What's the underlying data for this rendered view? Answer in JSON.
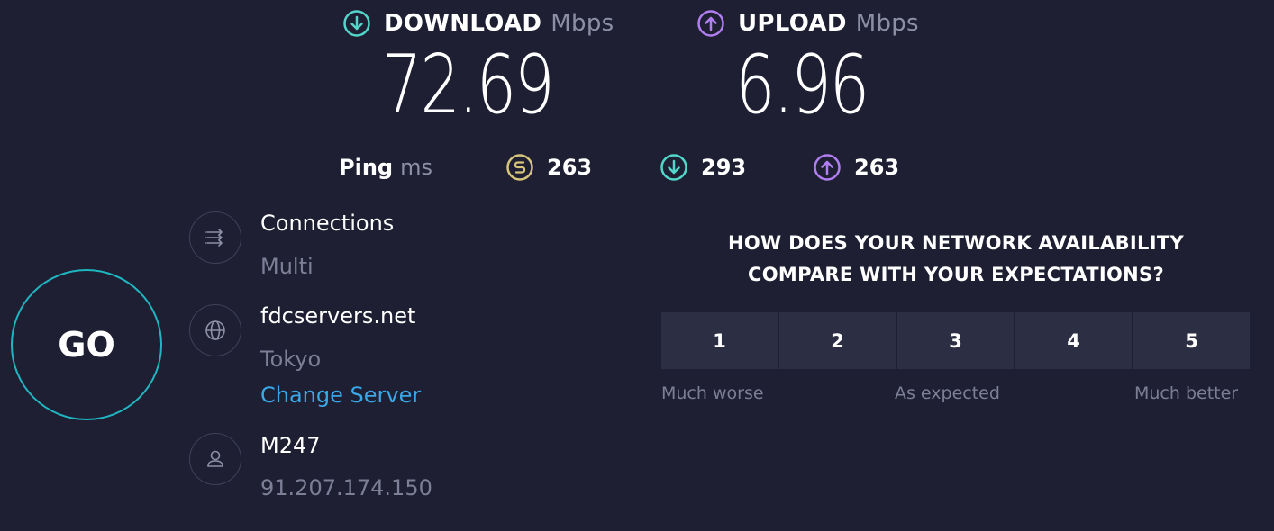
{
  "download": {
    "label": "DOWNLOAD",
    "unit": "Mbps",
    "value": "72.69",
    "icon": "download-arrow-icon",
    "color": "#52d6c9"
  },
  "upload": {
    "label": "UPLOAD",
    "unit": "Mbps",
    "value": "6.96",
    "icon": "upload-arrow-icon",
    "color": "#b07ef0"
  },
  "ping": {
    "label": "Ping",
    "unit": "ms",
    "idle": {
      "value": "263",
      "icon": "idle-ping-icon",
      "color": "#d7c57a"
    },
    "download": {
      "value": "293",
      "icon": "download-ping-icon",
      "color": "#52d6c9"
    },
    "upload": {
      "value": "263",
      "icon": "upload-ping-icon",
      "color": "#b07ef0"
    }
  },
  "go": {
    "label": "GO",
    "ring_color": "#1fb5c1"
  },
  "connections": {
    "title": "Connections",
    "value": "Multi",
    "icon": "connections-arrows-icon"
  },
  "server": {
    "title": "fdcservers.net",
    "location": "Tokyo",
    "change_link": "Change Server",
    "icon": "globe-icon",
    "link_color": "#3aa7e7"
  },
  "provider": {
    "title": "M247",
    "ip": "91.207.174.150",
    "icon": "user-icon"
  },
  "survey": {
    "question_line1": "HOW DOES YOUR NETWORK AVAILABILITY",
    "question_line2": "COMPARE WITH YOUR EXPECTATIONS?",
    "options": [
      "1",
      "2",
      "3",
      "4",
      "5"
    ],
    "scale": {
      "low": "Much worse",
      "mid": "As expected",
      "high": "Much better"
    }
  }
}
